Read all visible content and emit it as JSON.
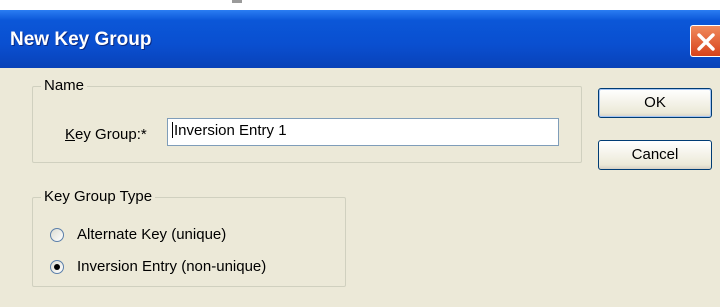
{
  "window": {
    "title": "New Key Group"
  },
  "name_group": {
    "legend": "Name",
    "key_group_label": "Key Group:*",
    "key_group_value": "Inversion Entry 1"
  },
  "buttons": {
    "ok": "OK",
    "cancel": "Cancel"
  },
  "type_group": {
    "legend": "Key Group Type",
    "options": [
      {
        "label": "Alternate Key (unique)",
        "selected": false
      },
      {
        "label": "Inversion Entry (non-unique)",
        "selected": true
      }
    ]
  }
}
